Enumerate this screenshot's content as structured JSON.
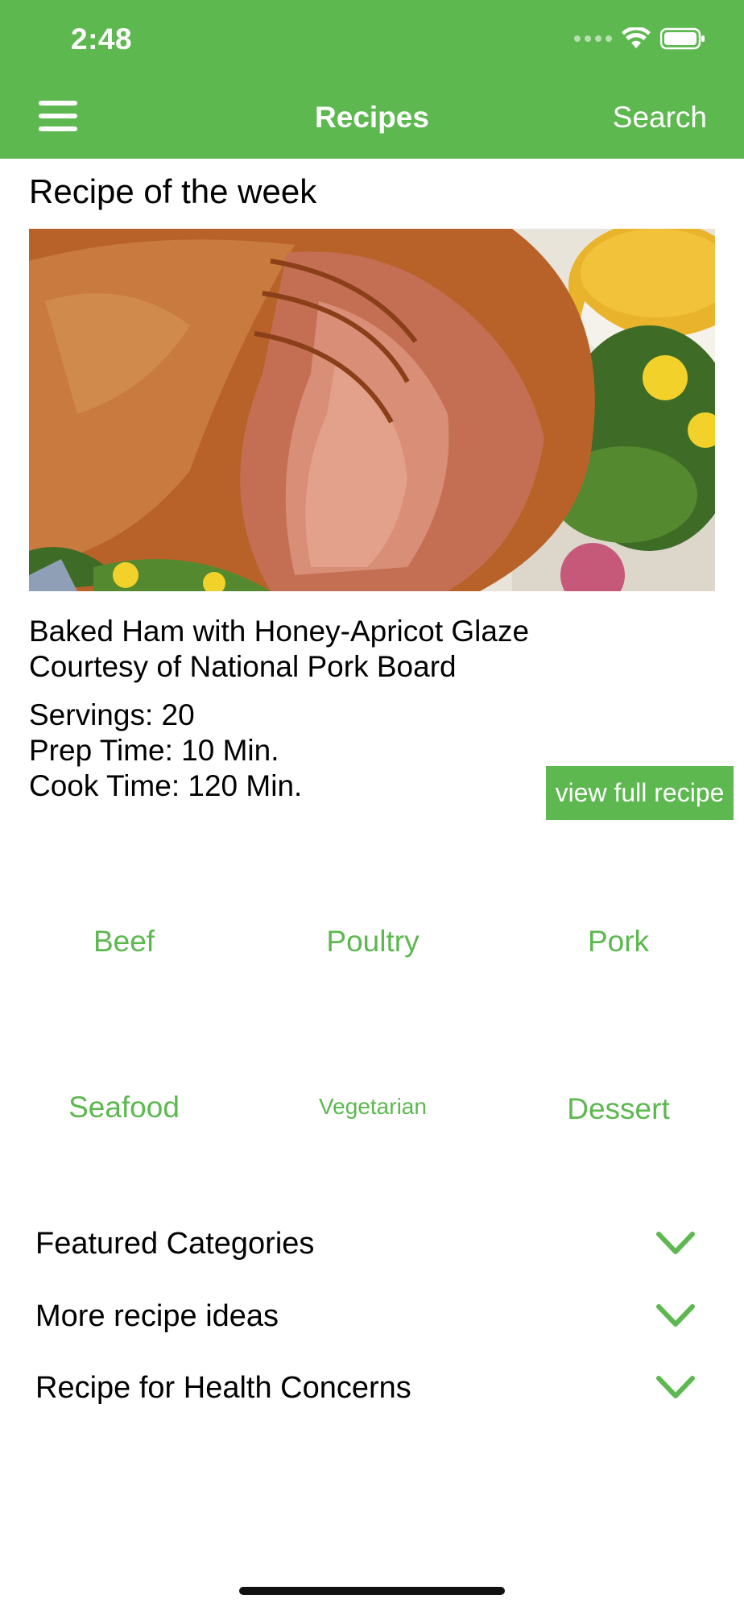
{
  "status_bar": {
    "time": "2:48"
  },
  "nav": {
    "title": "Recipes",
    "search_label": "Search"
  },
  "recipe_of_week": {
    "heading": "Recipe of the week",
    "name": "Baked Ham with Honey-Apricot Glaze",
    "courtesy": "Courtesy of National Pork Board",
    "servings": "Servings: 20",
    "prep_time": "Prep Time: 10 Min.",
    "cook_time": "Cook Time: 120 Min.",
    "view_button": "view full recipe"
  },
  "categories": [
    "Beef",
    "Poultry",
    "Pork",
    "Seafood",
    "Vegetarian",
    "Dessert"
  ],
  "accordions": [
    "Featured Categories",
    "More recipe ideas",
    "Recipe for Health Concerns"
  ],
  "colors": {
    "accent": "#5cb84f"
  }
}
